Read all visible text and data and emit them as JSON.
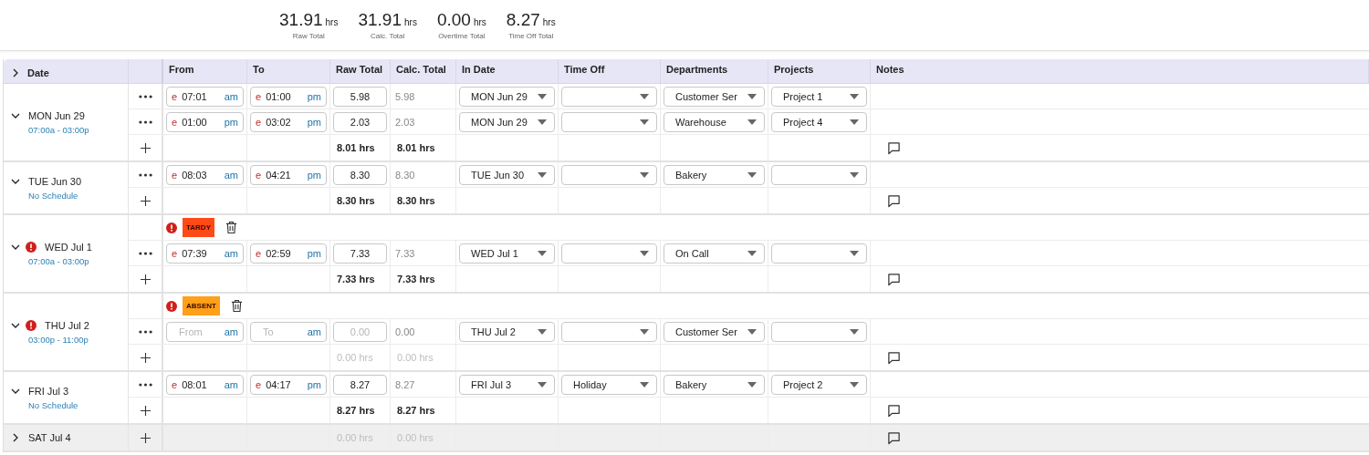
{
  "summary": [
    {
      "value": "31.91",
      "unit": "hrs",
      "label": "Raw Total"
    },
    {
      "value": "31.91",
      "unit": "hrs",
      "label": "Calc. Total"
    },
    {
      "value": "0.00",
      "unit": "hrs",
      "label": "Overtime Total"
    },
    {
      "value": "8.27",
      "unit": "hrs",
      "label": "Time Off Total"
    }
  ],
  "columns": [
    "Date",
    "From",
    "To",
    "Raw Total",
    "Calc. Total",
    "In Date",
    "Time Off",
    "Departments",
    "Projects",
    "Notes"
  ],
  "days": [
    {
      "day": "MON Jun 29",
      "schedule": "07:00a - 03:00p",
      "expanded": true,
      "warning": false,
      "entries": [
        {
          "from": {
            "marker": "e",
            "value": "07:01",
            "meridiem": "am"
          },
          "to": {
            "marker": "e",
            "value": "01:00",
            "meridiem": "pm"
          },
          "raw": "5.98",
          "calc": "5.98",
          "in_date": "MON Jun 29",
          "department": "Customer Ser",
          "project": "Project 1"
        },
        {
          "from": {
            "marker": "e",
            "value": "01:00",
            "meridiem": "pm"
          },
          "to": {
            "marker": "e",
            "value": "03:02",
            "meridiem": "pm"
          },
          "raw": "2.03",
          "calc": "2.03",
          "in_date": "MON Jun 29",
          "department": "Warehouse",
          "project": "Project 4"
        }
      ],
      "totals": {
        "raw": "8.01 hrs",
        "calc": "8.01 hrs",
        "empty": false
      }
    },
    {
      "day": "TUE Jun 30",
      "schedule": "No Schedule",
      "expanded": true,
      "warning": false,
      "entries": [
        {
          "from": {
            "marker": "e",
            "value": "08:03",
            "meridiem": "am"
          },
          "to": {
            "marker": "e",
            "value": "04:21",
            "meridiem": "pm"
          },
          "raw": "8.30",
          "calc": "8.30",
          "in_date": "TUE Jun 30",
          "department": "Bakery"
        }
      ],
      "totals": {
        "raw": "8.30 hrs",
        "calc": "8.30 hrs",
        "empty": false
      }
    },
    {
      "day": "WED Jul 1",
      "schedule": "07:00a - 03:00p",
      "expanded": true,
      "warning": true,
      "exception": {
        "label": "TARDY",
        "color": "#ff4a17"
      },
      "entries": [
        {
          "from": {
            "marker": "e",
            "value": "07:39",
            "meridiem": "am"
          },
          "to": {
            "marker": "e",
            "value": "02:59",
            "meridiem": "pm"
          },
          "raw": "7.33",
          "calc": "7.33",
          "in_date": "WED Jul 1",
          "department": "On Call"
        }
      ],
      "totals": {
        "raw": "7.33 hrs",
        "calc": "7.33 hrs",
        "empty": false
      }
    },
    {
      "day": "THU Jul 2",
      "schedule": "03:00p - 11:00p",
      "expanded": true,
      "warning": true,
      "exception": {
        "label": "ABSENT",
        "color": "#ff9f1a"
      },
      "entries": [
        {
          "from": {
            "placeholder": "From",
            "meridiem": "am"
          },
          "to": {
            "placeholder": "To",
            "meridiem": "am"
          },
          "raw_placeholder": "0.00",
          "calc": "0.00",
          "in_date": "THU Jul 2",
          "department": "Customer Ser"
        }
      ],
      "totals": {
        "raw": "0.00 hrs",
        "calc": "0.00 hrs",
        "empty": true
      }
    },
    {
      "day": "FRI Jul 3",
      "schedule": "No Schedule",
      "expanded": true,
      "warning": false,
      "entries": [
        {
          "from": {
            "marker": "e",
            "value": "08:01",
            "meridiem": "am"
          },
          "to": {
            "marker": "e",
            "value": "04:17",
            "meridiem": "pm"
          },
          "raw": "8.27",
          "calc": "8.27",
          "in_date": "FRI Jul 3",
          "time_off": "Holiday",
          "department": "Bakery",
          "project": "Project 2"
        }
      ],
      "totals": {
        "raw": "8.27 hrs",
        "calc": "8.27 hrs",
        "empty": false
      }
    },
    {
      "day": "SAT Jul 4",
      "expanded": false,
      "warning": false,
      "totals": {
        "raw": "0.00 hrs",
        "calc": "0.00 hrs",
        "empty": true
      }
    }
  ]
}
